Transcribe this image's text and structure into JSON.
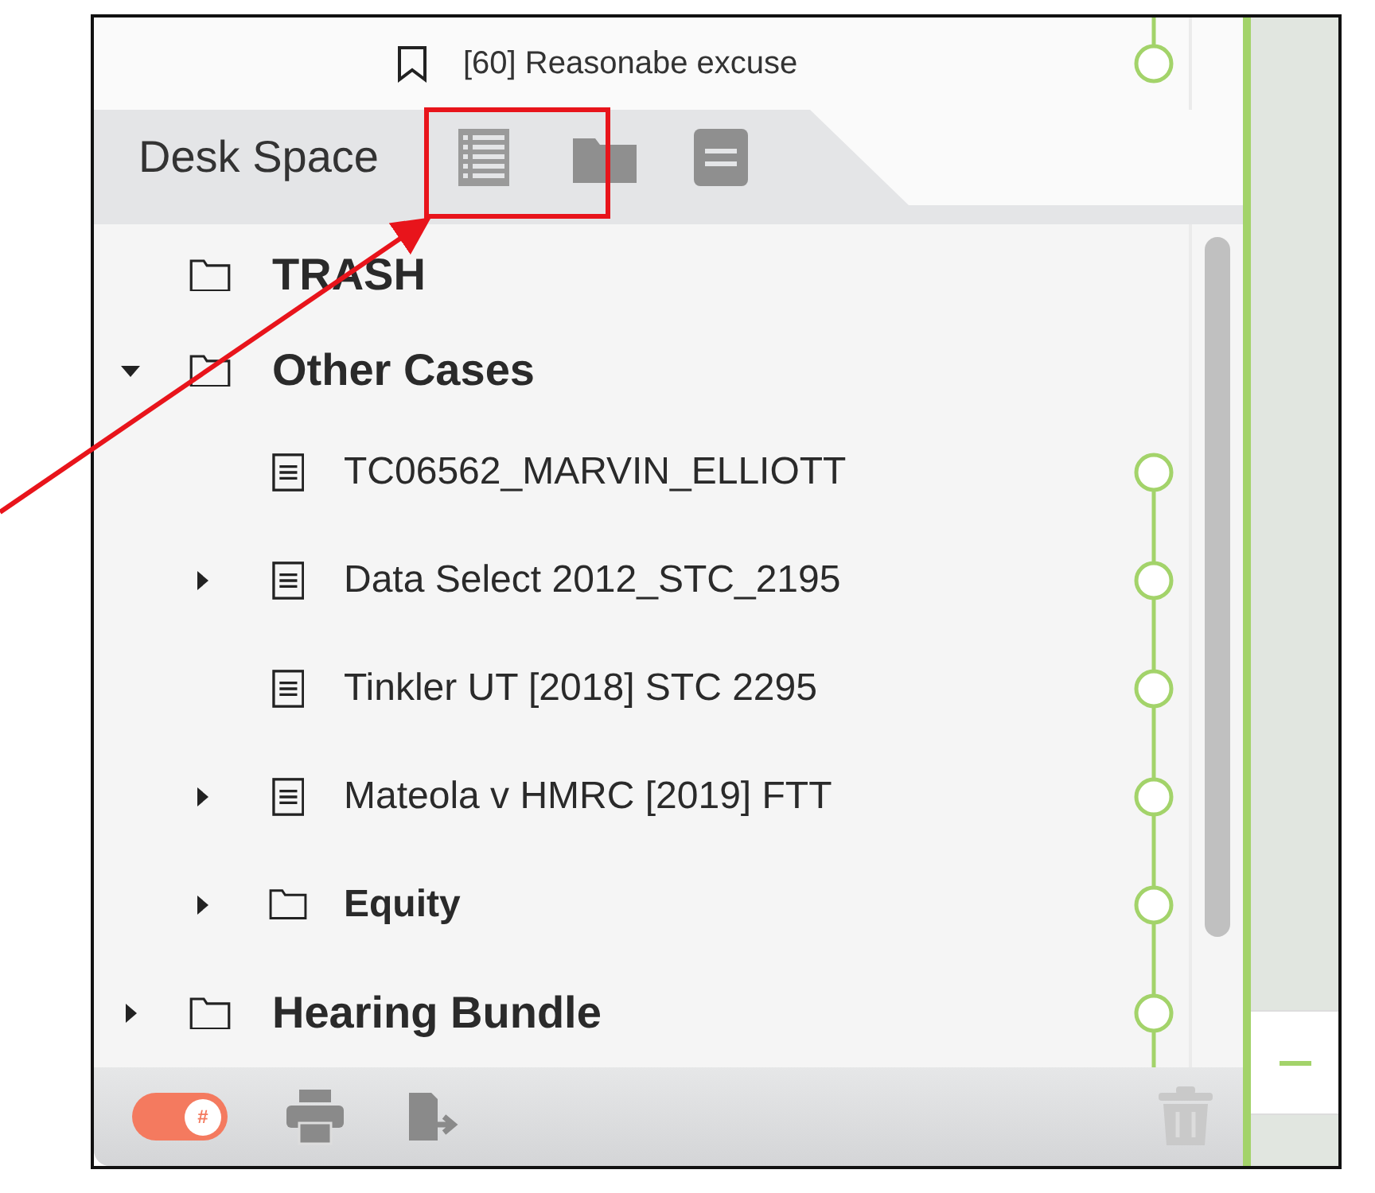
{
  "top_item": {
    "label": "[60] Reasonabe excuse",
    "linked": true
  },
  "header": {
    "title": "Desk Space",
    "tools": [
      {
        "kind": "list"
      },
      {
        "kind": "folder"
      },
      {
        "kind": "document"
      }
    ]
  },
  "tree": [
    {
      "kind": "folder",
      "label": "TRASH",
      "expandable": false,
      "linked": false
    },
    {
      "kind": "folder",
      "label": "Other Cases",
      "expandable": true,
      "expanded": true,
      "linked": false,
      "children": [
        {
          "kind": "document",
          "label": "TC06562_MARVIN_ELLIOTT",
          "expandable": false,
          "linked": true
        },
        {
          "kind": "document",
          "label": "Data Select 2012_STC_2195",
          "expandable": true,
          "expanded": false,
          "linked": true
        },
        {
          "kind": "document",
          "label": "Tinkler UT [2018] STC 2295",
          "expandable": false,
          "linked": true
        },
        {
          "kind": "document",
          "label": "Mateola v HMRC [2019] FTT",
          "expandable": true,
          "expanded": false,
          "linked": true
        },
        {
          "kind": "folder",
          "label": "Equity",
          "expandable": true,
          "expanded": false,
          "linked": true
        }
      ]
    },
    {
      "kind": "folder",
      "label": "Hearing Bundle",
      "expandable": true,
      "expanded": false,
      "linked": true
    }
  ],
  "footer": {
    "toggle": {
      "label": "#",
      "on": true
    },
    "trash_disabled": true
  },
  "annotation": {
    "highlight": true
  }
}
